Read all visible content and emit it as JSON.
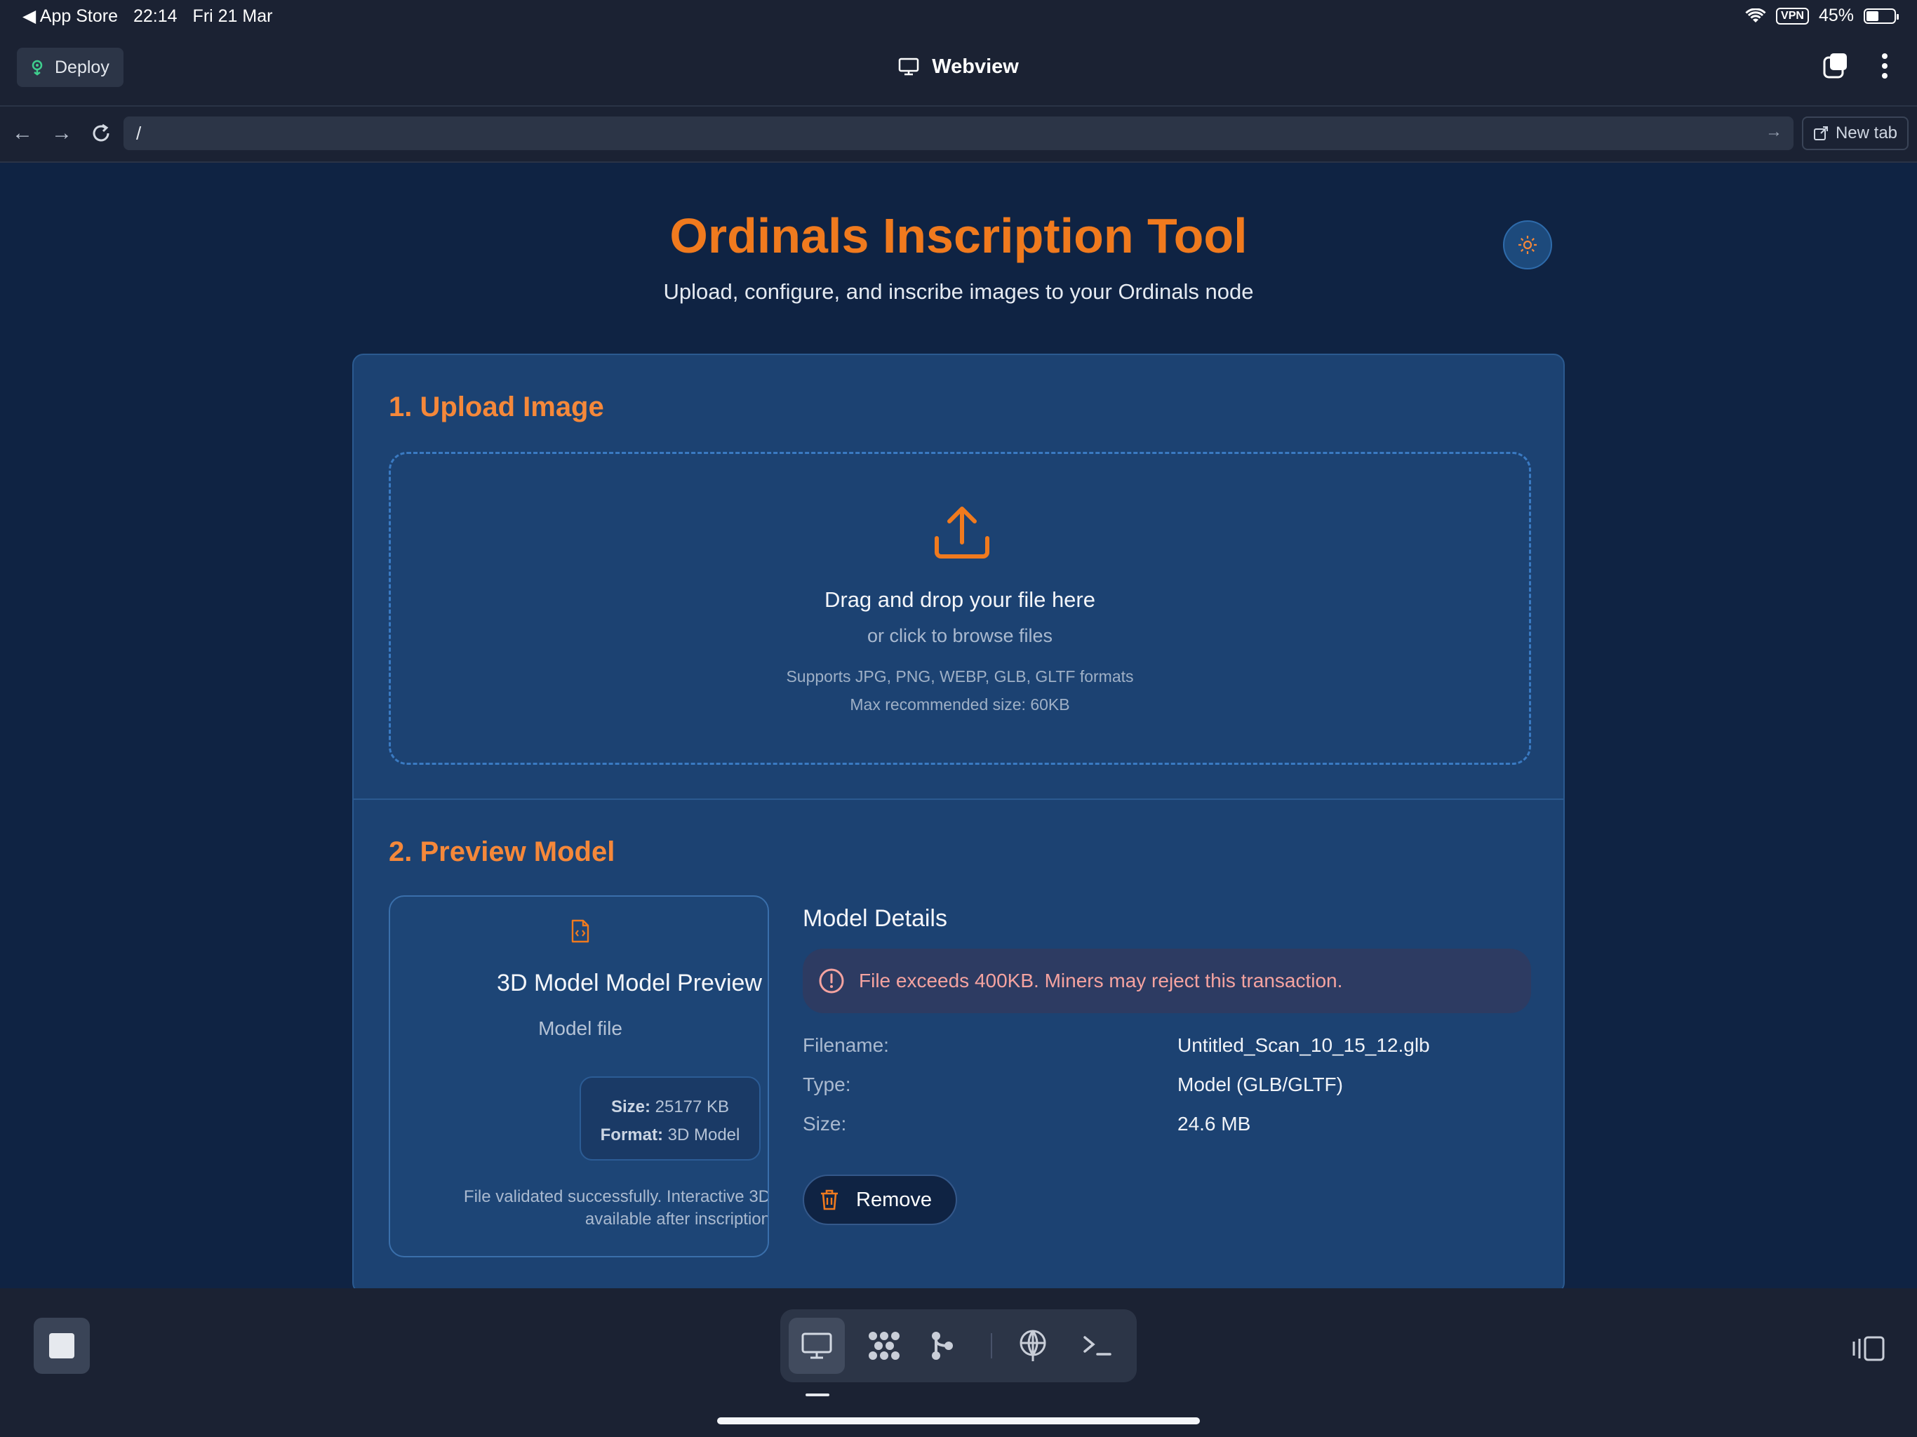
{
  "status_bar": {
    "back_app": "◀ App Store",
    "time": "22:14",
    "date": "Fri 21 Mar",
    "vpn": "VPN",
    "battery": "45%",
    "battery_level": 0.45
  },
  "app_header": {
    "deploy_label": "Deploy",
    "title": "Webview"
  },
  "url_bar": {
    "url": "/",
    "new_tab_label": "New tab"
  },
  "page": {
    "title": "Ordinals Inscription Tool",
    "subtitle": "Upload, configure, and inscribe images to your Ordinals node",
    "upload": {
      "heading": "1. Upload Image",
      "drop_text": "Drag and drop your file here",
      "browse_text": "or click to browse files",
      "formats": "Supports JPG, PNG, WEBP, GLB, GLTF formats",
      "max_size": "Max recommended size: 60KB"
    },
    "preview": {
      "heading": "2. Preview Model",
      "card_title": "3D Model Model Preview",
      "card_subtitle": "Model file",
      "size_label": "Size:",
      "size_value": "25177 KB",
      "format_label": "Format:",
      "format_value": "3D Model",
      "footer_line1": "File validated successfully. Interactive 3D",
      "footer_line2": "available after inscription"
    },
    "details": {
      "heading": "Model Details",
      "warning": "File exceeds 400KB. Miners may reject this transaction.",
      "rows": [
        {
          "label": "Filename:",
          "value": "Untitled_Scan_10_15_12.glb"
        },
        {
          "label": "Type:",
          "value": "Model (GLB/GLTF)"
        },
        {
          "label": "Size:",
          "value": "24.6 MB"
        }
      ],
      "remove_label": "Remove"
    }
  },
  "colors": {
    "accent": "#f07a1e",
    "page_bg": "#0f2343",
    "card_bg": "#1c4272",
    "warning_text": "#f5a3a0"
  }
}
